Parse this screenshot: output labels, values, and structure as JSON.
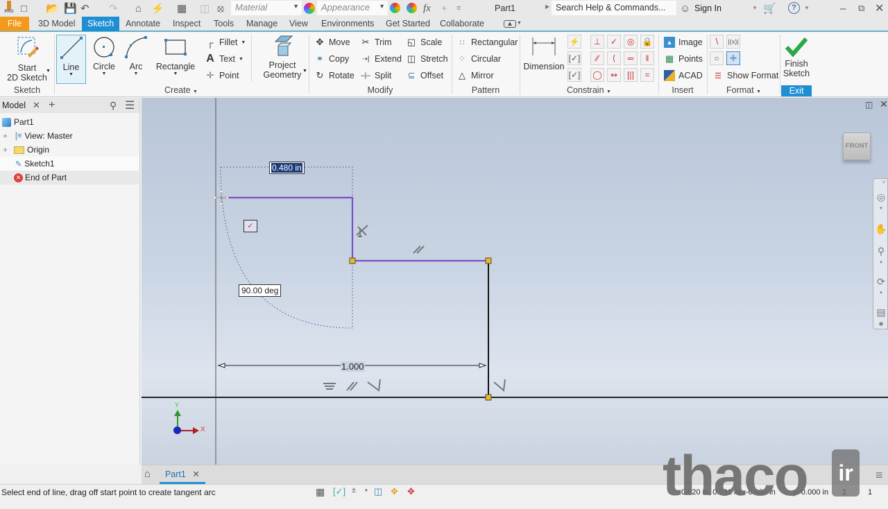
{
  "app": {
    "title": "Part1",
    "logo": "PRO"
  },
  "qat": {
    "icons": [
      "new-icon",
      "open-icon",
      "save-icon",
      "undo-icon",
      "redo-icon",
      "home-icon",
      "update-icon",
      "select-icon",
      "measure-icon",
      "material-icon"
    ],
    "material_placeholder": "Material",
    "appearance_placeholder": "Appearance",
    "search_placeholder": "Search Help & Commands...",
    "sign_in": "Sign In"
  },
  "tabs": [
    "File",
    "3D Model",
    "Sketch",
    "Annotate",
    "Inspect",
    "Tools",
    "Manage",
    "View",
    "Environments",
    "Get Started",
    "Collaborate"
  ],
  "active_tab": "Sketch",
  "ribbon": {
    "sketch_group": {
      "start_line1": "Start",
      "start_line2": "2D Sketch",
      "label": "Sketch"
    },
    "create_group": {
      "line": "Line",
      "circle": "Circle",
      "arc": "Arc",
      "rectangle": "Rectangle",
      "fillet": "Fillet",
      "text": "Text",
      "point": "Point",
      "project_line1": "Project",
      "project_line2": "Geometry",
      "label": "Create"
    },
    "modify_group": {
      "move": "Move",
      "copy": "Copy",
      "rotate": "Rotate",
      "trim": "Trim",
      "extend": "Extend",
      "split": "Split",
      "scale": "Scale",
      "stretch": "Stretch",
      "offset": "Offset",
      "label": "Modify"
    },
    "pattern_group": {
      "rectangular": "Rectangular",
      "circular": "Circular",
      "mirror": "Mirror",
      "label": "Pattern"
    },
    "constrain_group": {
      "dimension": "Dimension",
      "label": "Constrain"
    },
    "insert_group": {
      "image": "Image",
      "points": "Points",
      "acad": "ACAD",
      "label": "Insert"
    },
    "format_group": {
      "show_format": "Show Format",
      "label": "Format"
    },
    "exit_group": {
      "finish_line1": "Finish",
      "finish_line2": "Sketch",
      "label": "Exit"
    }
  },
  "browser": {
    "tab": "Model",
    "tree": [
      {
        "label": "Part1",
        "icon": "part-icon"
      },
      {
        "label": "View: Master",
        "icon": "view-icon"
      },
      {
        "label": "Origin",
        "icon": "folder-icon"
      },
      {
        "label": "Sketch1",
        "icon": "sketch-icon"
      },
      {
        "label": "End of Part",
        "icon": "end-of-part-icon"
      }
    ]
  },
  "canvas": {
    "viewcube": "FRONT",
    "dim_input": "0.480 in",
    "angle_input": "90.00 deg",
    "dimension_value": "1.000",
    "axis_x": "X",
    "axis_y": "Y"
  },
  "doc_tabs": [
    {
      "label": "Part1"
    }
  ],
  "status": {
    "prompt": "Select end of line, drag off start point to create tangent arc",
    "coords": "0.020 in, 0.731 in",
    "x": "x=-0.480 in",
    "y": "y=0.000 in",
    "count1": "1",
    "count2": "1"
  },
  "watermark": {
    "text": "thaco",
    "suffix": "ir"
  },
  "colors": {
    "accent": "#1f8fd4",
    "file_tab": "#f39a1e",
    "sketch_line": "#7a4fc4",
    "finish_check": "#2aa84a"
  }
}
